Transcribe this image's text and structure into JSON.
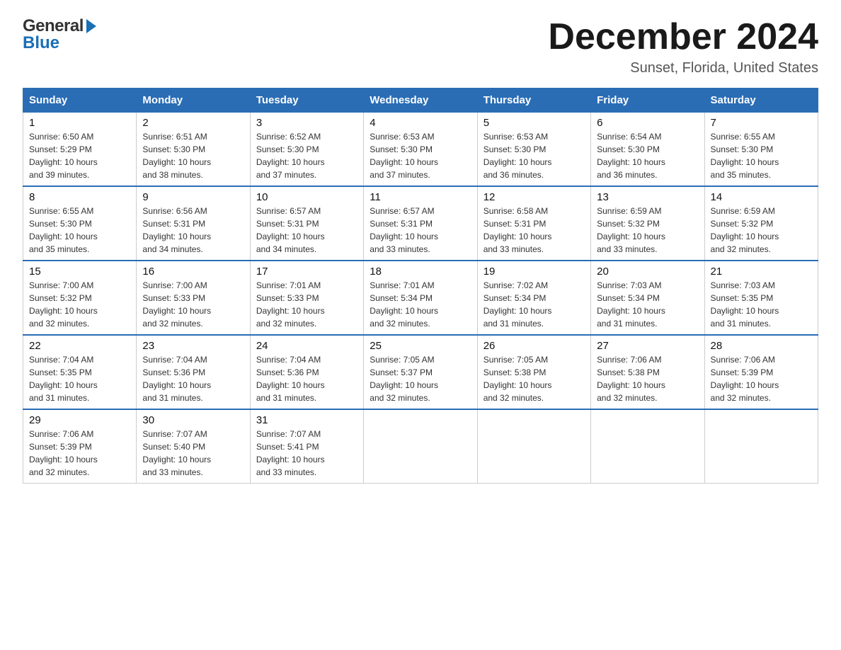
{
  "logo": {
    "general_text": "General",
    "blue_text": "Blue"
  },
  "header": {
    "month_year": "December 2024",
    "location": "Sunset, Florida, United States"
  },
  "weekdays": [
    "Sunday",
    "Monday",
    "Tuesday",
    "Wednesday",
    "Thursday",
    "Friday",
    "Saturday"
  ],
  "weeks": [
    [
      {
        "day": "1",
        "sunrise": "6:50 AM",
        "sunset": "5:29 PM",
        "daylight": "10 hours and 39 minutes."
      },
      {
        "day": "2",
        "sunrise": "6:51 AM",
        "sunset": "5:30 PM",
        "daylight": "10 hours and 38 minutes."
      },
      {
        "day": "3",
        "sunrise": "6:52 AM",
        "sunset": "5:30 PM",
        "daylight": "10 hours and 37 minutes."
      },
      {
        "day": "4",
        "sunrise": "6:53 AM",
        "sunset": "5:30 PM",
        "daylight": "10 hours and 37 minutes."
      },
      {
        "day": "5",
        "sunrise": "6:53 AM",
        "sunset": "5:30 PM",
        "daylight": "10 hours and 36 minutes."
      },
      {
        "day": "6",
        "sunrise": "6:54 AM",
        "sunset": "5:30 PM",
        "daylight": "10 hours and 36 minutes."
      },
      {
        "day": "7",
        "sunrise": "6:55 AM",
        "sunset": "5:30 PM",
        "daylight": "10 hours and 35 minutes."
      }
    ],
    [
      {
        "day": "8",
        "sunrise": "6:55 AM",
        "sunset": "5:30 PM",
        "daylight": "10 hours and 35 minutes."
      },
      {
        "day": "9",
        "sunrise": "6:56 AM",
        "sunset": "5:31 PM",
        "daylight": "10 hours and 34 minutes."
      },
      {
        "day": "10",
        "sunrise": "6:57 AM",
        "sunset": "5:31 PM",
        "daylight": "10 hours and 34 minutes."
      },
      {
        "day": "11",
        "sunrise": "6:57 AM",
        "sunset": "5:31 PM",
        "daylight": "10 hours and 33 minutes."
      },
      {
        "day": "12",
        "sunrise": "6:58 AM",
        "sunset": "5:31 PM",
        "daylight": "10 hours and 33 minutes."
      },
      {
        "day": "13",
        "sunrise": "6:59 AM",
        "sunset": "5:32 PM",
        "daylight": "10 hours and 33 minutes."
      },
      {
        "day": "14",
        "sunrise": "6:59 AM",
        "sunset": "5:32 PM",
        "daylight": "10 hours and 32 minutes."
      }
    ],
    [
      {
        "day": "15",
        "sunrise": "7:00 AM",
        "sunset": "5:32 PM",
        "daylight": "10 hours and 32 minutes."
      },
      {
        "day": "16",
        "sunrise": "7:00 AM",
        "sunset": "5:33 PM",
        "daylight": "10 hours and 32 minutes."
      },
      {
        "day": "17",
        "sunrise": "7:01 AM",
        "sunset": "5:33 PM",
        "daylight": "10 hours and 32 minutes."
      },
      {
        "day": "18",
        "sunrise": "7:01 AM",
        "sunset": "5:34 PM",
        "daylight": "10 hours and 32 minutes."
      },
      {
        "day": "19",
        "sunrise": "7:02 AM",
        "sunset": "5:34 PM",
        "daylight": "10 hours and 31 minutes."
      },
      {
        "day": "20",
        "sunrise": "7:03 AM",
        "sunset": "5:34 PM",
        "daylight": "10 hours and 31 minutes."
      },
      {
        "day": "21",
        "sunrise": "7:03 AM",
        "sunset": "5:35 PM",
        "daylight": "10 hours and 31 minutes."
      }
    ],
    [
      {
        "day": "22",
        "sunrise": "7:04 AM",
        "sunset": "5:35 PM",
        "daylight": "10 hours and 31 minutes."
      },
      {
        "day": "23",
        "sunrise": "7:04 AM",
        "sunset": "5:36 PM",
        "daylight": "10 hours and 31 minutes."
      },
      {
        "day": "24",
        "sunrise": "7:04 AM",
        "sunset": "5:36 PM",
        "daylight": "10 hours and 31 minutes."
      },
      {
        "day": "25",
        "sunrise": "7:05 AM",
        "sunset": "5:37 PM",
        "daylight": "10 hours and 32 minutes."
      },
      {
        "day": "26",
        "sunrise": "7:05 AM",
        "sunset": "5:38 PM",
        "daylight": "10 hours and 32 minutes."
      },
      {
        "day": "27",
        "sunrise": "7:06 AM",
        "sunset": "5:38 PM",
        "daylight": "10 hours and 32 minutes."
      },
      {
        "day": "28",
        "sunrise": "7:06 AM",
        "sunset": "5:39 PM",
        "daylight": "10 hours and 32 minutes."
      }
    ],
    [
      {
        "day": "29",
        "sunrise": "7:06 AM",
        "sunset": "5:39 PM",
        "daylight": "10 hours and 32 minutes."
      },
      {
        "day": "30",
        "sunrise": "7:07 AM",
        "sunset": "5:40 PM",
        "daylight": "10 hours and 33 minutes."
      },
      {
        "day": "31",
        "sunrise": "7:07 AM",
        "sunset": "5:41 PM",
        "daylight": "10 hours and 33 minutes."
      },
      null,
      null,
      null,
      null
    ]
  ],
  "labels": {
    "sunrise": "Sunrise:",
    "sunset": "Sunset:",
    "daylight": "Daylight:"
  }
}
